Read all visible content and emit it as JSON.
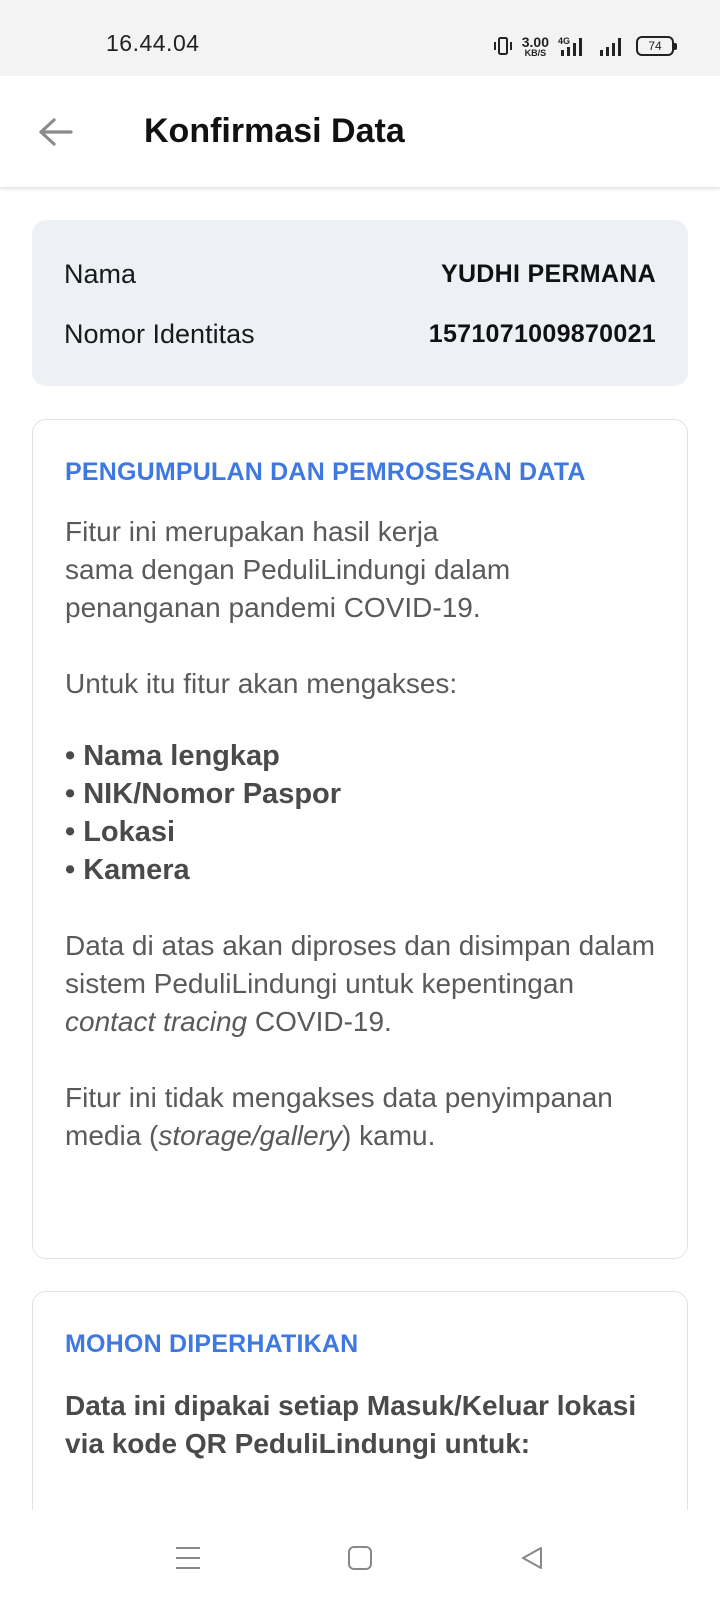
{
  "status_bar": {
    "time": "16.44.04",
    "net_speed_value": "3.00",
    "net_speed_unit": "KB/S",
    "network_type": "4G",
    "battery": "74",
    "icons": [
      "vibrate-icon",
      "signal-4g-icon",
      "signal-icon",
      "battery-icon"
    ]
  },
  "header": {
    "title": "Konfirmasi Data",
    "back_icon": "arrow-left-icon"
  },
  "identity": {
    "name_label": "Nama",
    "name_value": "YUDHI PERMANA",
    "id_label": "Nomor Identitas",
    "id_value": "1571071009870021"
  },
  "data_collection": {
    "heading": "PENGUMPULAN DAN PEMROSESAN DATA",
    "intro_line1": "Fitur ini merupakan hasil kerja",
    "intro_line2": "sama dengan PeduliLindungi dalam penanganan pandemi COVID-19.",
    "access_text": "Untuk itu fitur akan mengakses:",
    "items": [
      "Nama lengkap",
      "NIK/Nomor Paspor",
      "Lokasi",
      "Kamera"
    ],
    "process_text_before": "Data di atas akan diproses dan disimpan dalam sistem PeduliLindungi untuk kepentingan ",
    "process_text_italic": "contact tracing",
    "process_text_after": " COVID-19.",
    "storage_text_before": "Fitur ini tidak mengakses data penyimpanan media (",
    "storage_text_italic": "storage/gallery",
    "storage_text_after": ") kamu."
  },
  "notice": {
    "heading": "MOHON DIPERHATIKAN",
    "text": "Data ini dipakai setiap Masuk/Keluar lokasi via kode QR PeduliLindungi untuk:"
  },
  "nav_bar": {
    "icons": [
      "menu-icon",
      "home-icon",
      "back-triangle-icon"
    ]
  },
  "colors": {
    "accent": "#3f78e0",
    "identity_bg": "#edf0f5",
    "status_bg": "#f3f3f3"
  }
}
